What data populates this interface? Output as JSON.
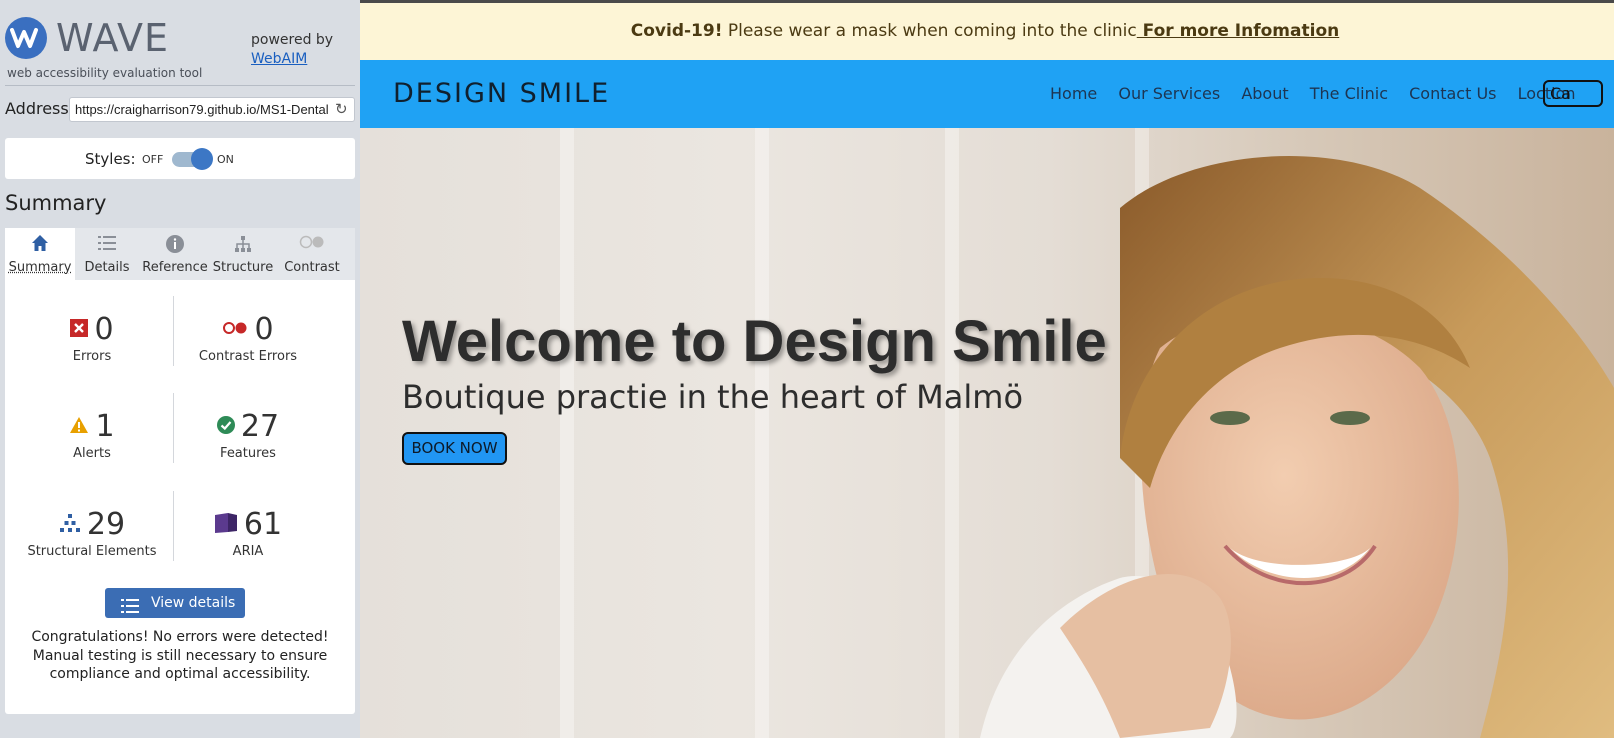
{
  "wave": {
    "title": "WAVE",
    "subtitle": "web accessibility evaluation tool",
    "powered_by": "powered by",
    "webaim_link": "WebAIM",
    "address_label": "Address:",
    "address_value": "https://craigharrison79.github.io/MS1-Dental",
    "styles_label": "Styles:",
    "styles_off": "OFF",
    "styles_on": "ON",
    "summary_heading": "Summary",
    "tabs": [
      {
        "label": "Summary",
        "icon": "home-icon",
        "active": true
      },
      {
        "label": "Details",
        "icon": "list-icon",
        "active": false
      },
      {
        "label": "Reference",
        "icon": "info-icon",
        "active": false
      },
      {
        "label": "Structure",
        "icon": "hierarchy-icon",
        "active": false
      },
      {
        "label": "Contrast",
        "icon": "contrast-icon",
        "active": false
      }
    ],
    "stats": [
      {
        "count": "0",
        "label": "Errors",
        "icon": "error-icon",
        "color": "#c62828"
      },
      {
        "count": "0",
        "label": "Contrast Errors",
        "icon": "contrast-error-icon",
        "color": "#c62828"
      },
      {
        "count": "1",
        "label": "Alerts",
        "icon": "alert-icon",
        "color": "#e8a000"
      },
      {
        "count": "27",
        "label": "Features",
        "icon": "check-icon",
        "color": "#2e8b57"
      },
      {
        "count": "29",
        "label": "Structural Elements",
        "icon": "structure-icon",
        "color": "#2f5fa3"
      },
      {
        "count": "61",
        "label": "ARIA",
        "icon": "aria-icon",
        "color": "#5b3a8e"
      }
    ],
    "view_details": "View details ›",
    "congrats": "Congratulations! No errors were detected! Manual testing is still necessary to ensure compliance and optimal accessibility."
  },
  "site": {
    "banner_bold": "Covid-19!",
    "banner_text": " Please wear a mask when coming into the clinic",
    "banner_link": " For more Infomation",
    "brand": "DESIGN SMILE",
    "nav": [
      "Home",
      "Our Services",
      "About",
      "The Clinic",
      "Contact Us",
      "Loction"
    ],
    "nav_button": "Ca",
    "hero_title": "Welcome to Design Smile",
    "hero_subtitle": "Boutique practie in the heart of Malmö",
    "book_button": "BOOK NOW",
    "colors": {
      "nav_bg": "#1fa2f4",
      "banner_bg": "#fdf5d6",
      "wave_accent": "#3b6db4"
    }
  }
}
